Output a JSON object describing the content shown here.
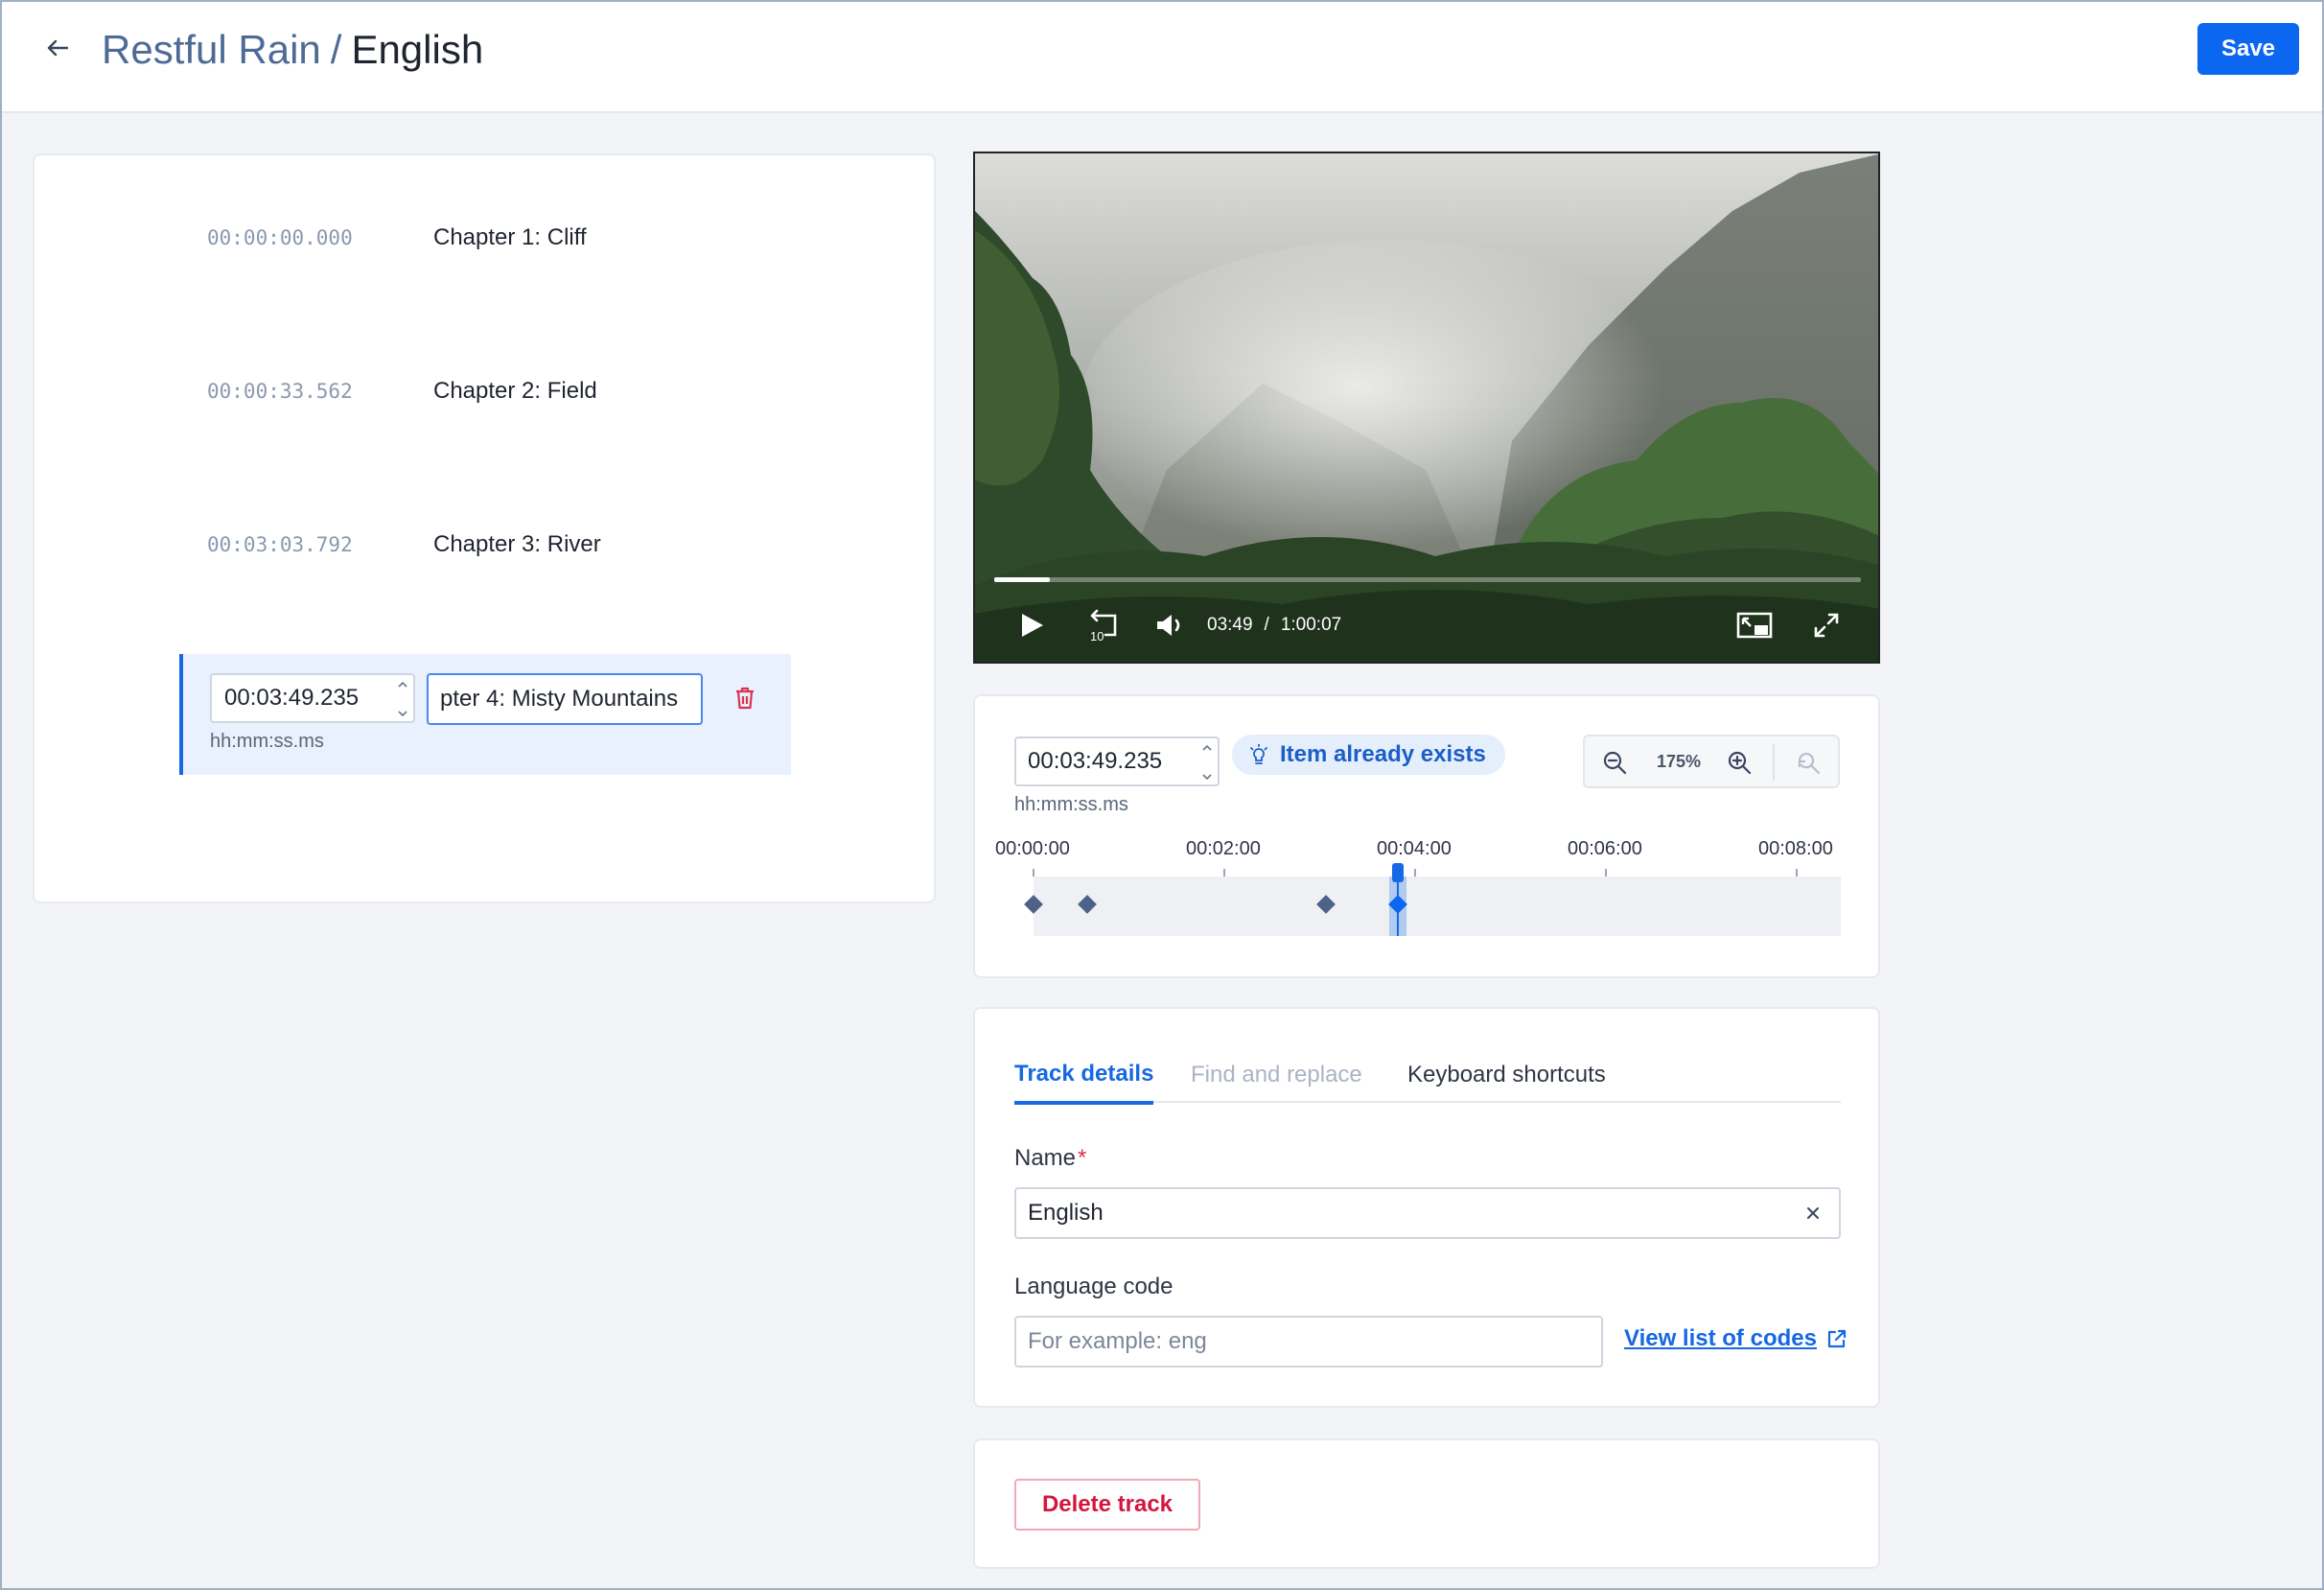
{
  "header": {
    "parent_title": "Restful Rain",
    "separator": "/",
    "current_title": "English",
    "save_label": "Save"
  },
  "chapters": {
    "items": [
      {
        "time": "00:00:00.000",
        "title": "Chapter 1: Cliff"
      },
      {
        "time": "00:00:33.562",
        "title": "Chapter 2: Field"
      },
      {
        "time": "00:03:03.792",
        "title": "Chapter 3: River"
      }
    ],
    "editing": {
      "time_value": "00:03:49.235",
      "title_value": "pter 4: Misty Mountains",
      "hint": "hh:mm:ss.ms"
    }
  },
  "video": {
    "current_time": "03:49",
    "separator": "/",
    "duration": "1:00:07",
    "progress_fraction": 0.064,
    "replay_seconds": "10"
  },
  "timeline": {
    "time_value": "00:03:49.235",
    "hint": "hh:mm:ss.ms",
    "badge": "Item already exists",
    "zoom": "175%",
    "ticks": [
      "00:00:00",
      "00:02:00",
      "00:04:00",
      "00:06:00",
      "00:08:00"
    ],
    "tick_seconds": [
      0,
      120,
      240,
      360,
      480
    ],
    "markers_seconds": [
      0,
      33.562,
      183.792,
      229.235
    ],
    "playhead_seconds": 229.235
  },
  "details": {
    "tabs": [
      {
        "label": "Track details",
        "state": "active"
      },
      {
        "label": "Find and replace",
        "state": "disabled"
      },
      {
        "label": "Keyboard shortcuts",
        "state": "normal"
      }
    ],
    "name_label": "Name",
    "required_mark": "*",
    "name_value": "English",
    "language_label": "Language code",
    "language_placeholder": "For example: eng",
    "codes_link": "View list of codes"
  },
  "delete_label": "Delete track",
  "colors": {
    "accent": "#0b66f0",
    "danger": "#d3163d",
    "marker": "#4e6189"
  }
}
